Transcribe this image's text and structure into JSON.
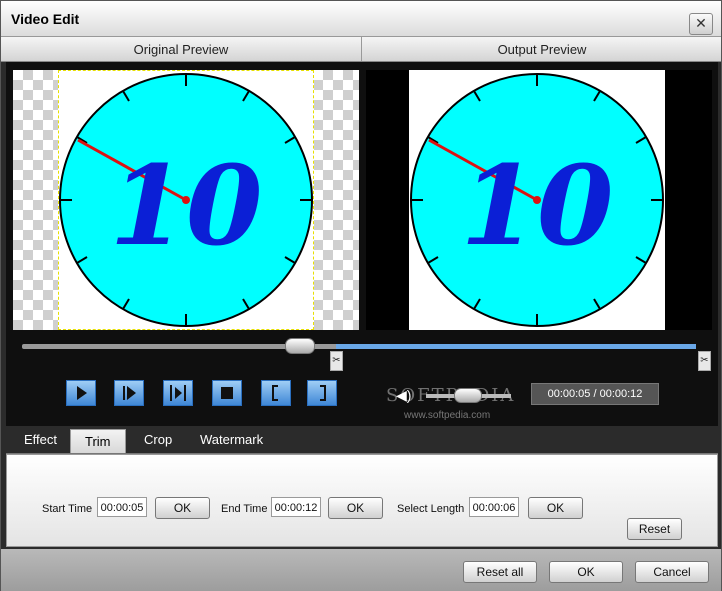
{
  "window": {
    "title": "Video Edit",
    "close_glyph": "✕"
  },
  "preview": {
    "original_label": "Original Preview",
    "output_label": "Output Preview",
    "clock_number": "10"
  },
  "playback": {
    "time": "00:00:05 / 00:00:12",
    "marker_glyph": "✂",
    "volume_glyph": "◀)",
    "watermark": "SOFTPEDIA",
    "watermark_url": "www.softpedia.com"
  },
  "tabs": [
    {
      "label": "Effect"
    },
    {
      "label": "Trim"
    },
    {
      "label": "Crop"
    },
    {
      "label": "Watermark"
    }
  ],
  "trim": {
    "start_label": "Start Time",
    "start_value": "00:00:05",
    "end_label": "End Time",
    "end_value": "00:00:12",
    "length_label": "Select Length",
    "length_value": "00:00:06",
    "ok_label": "OK",
    "reset_label": "Reset"
  },
  "footer": {
    "reset_all_label": "Reset all",
    "ok_label": "OK",
    "cancel_label": "Cancel"
  },
  "colors": {
    "clock_face": "#00ffff",
    "digits": "#0b1fd6",
    "hand": "#d11"
  }
}
